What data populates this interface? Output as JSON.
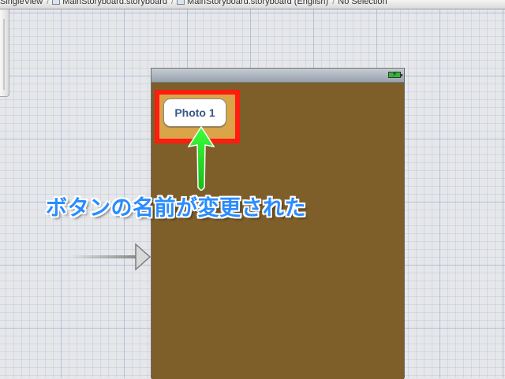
{
  "jumpbar": {
    "crumbs": [
      {
        "label": "SingleView",
        "icon": "project-icon"
      },
      {
        "label": "MainStoryboard.storyboard",
        "icon": "storyboard-file-icon"
      },
      {
        "label": "MainStoryboard.storyboard (English)",
        "icon": "storyboard-file-icon"
      },
      {
        "label": "No Selection",
        "icon": ""
      }
    ]
  },
  "scene": {
    "status_bar": {
      "battery_icon": "battery-charging-icon",
      "battery_color": "#37b338"
    },
    "view_background": "#7e5f2a",
    "button": {
      "label": "Photo 1"
    }
  },
  "annotation": {
    "caption": "ボタンの名前が変更された",
    "caption_color": "#2a8cff",
    "highlight_color": "#ff1c10",
    "arrow_color": "#2ee82a"
  },
  "entry_point": {
    "icon": "storyboard-entry-arrow-icon"
  }
}
